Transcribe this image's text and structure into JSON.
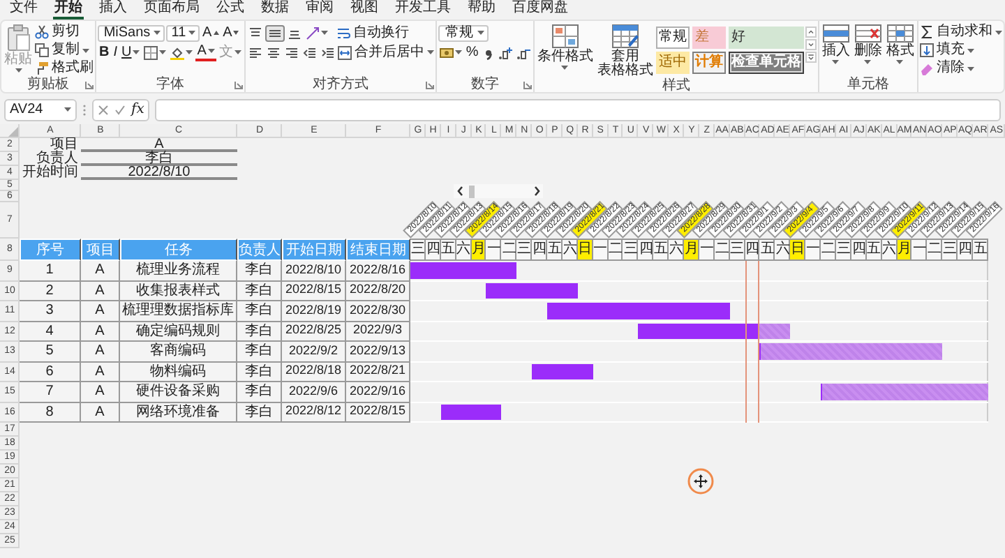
{
  "ribbon": {
    "tabs": [
      {
        "label": "文件",
        "selected": false
      },
      {
        "label": "开始",
        "selected": true
      },
      {
        "label": "插入",
        "selected": false
      },
      {
        "label": "页面布局",
        "selected": false
      },
      {
        "label": "公式",
        "selected": false
      },
      {
        "label": "数据",
        "selected": false
      },
      {
        "label": "审阅",
        "selected": false
      },
      {
        "label": "视图",
        "selected": false
      },
      {
        "label": "开发工具",
        "selected": false
      },
      {
        "label": "帮助",
        "selected": false
      },
      {
        "label": "百度网盘",
        "selected": false
      }
    ],
    "clipboard": {
      "paste": "粘贴",
      "cut": "剪切",
      "copy": "复制",
      "format_painter": "格式刷",
      "label": "剪贴板"
    },
    "font": {
      "name": "MiSans",
      "size": "11",
      "grow": "A",
      "shrink": "A",
      "bold": "B",
      "italic": "I",
      "underline": "U",
      "font_color": "A",
      "phonetic": "文",
      "label": "字体"
    },
    "alignment": {
      "vertical": [
        {
          "selected": false
        },
        {
          "selected": true
        },
        {
          "selected": false
        }
      ],
      "wrap_text": "自动换行",
      "merge_center": "合并后居中",
      "label": "对齐方式"
    },
    "number": {
      "format": "常规",
      "percent": "%",
      "label": "数字"
    },
    "styles": {
      "conditional_format": "条件格式",
      "table_format": [
        "套用",
        "表格格式"
      ],
      "cell_styles": [
        {
          "label": "常规",
          "kind": "normal"
        },
        {
          "label": "差",
          "kind": "bad"
        },
        {
          "label": "好",
          "kind": "good"
        },
        {
          "label": "适中",
          "kind": "neutral"
        },
        {
          "label": "计算",
          "kind": "calculation"
        },
        {
          "label": "检查单元格",
          "kind": "check"
        }
      ],
      "label": "样式"
    },
    "cells": {
      "insert": "插入",
      "delete": "删除",
      "format": "格式",
      "label": "单元格"
    },
    "editing": {
      "autosum": "自动求和",
      "fill": "填充",
      "clear": "清除"
    }
  },
  "formula_bar": {
    "name_box": "AV24",
    "fx": "fx"
  },
  "sheet": {
    "columns": [
      "A",
      "B",
      "C",
      "D",
      "E",
      "F",
      "G",
      "H",
      "I",
      "J",
      "K",
      "L",
      "M",
      "N",
      "O",
      "P",
      "Q",
      "R",
      "S",
      "T",
      "U",
      "V",
      "W",
      "X",
      "Y",
      "Z",
      "AA",
      "AB",
      "AC",
      "AD",
      "AE",
      "AF",
      "AG",
      "AH",
      "AI",
      "AJ",
      "AK",
      "AL",
      "AM",
      "AN",
      "AO",
      "AP",
      "AQ",
      "AR",
      "AS"
    ],
    "rows": [
      "2",
      "3",
      "4",
      "5",
      "6",
      "7",
      "8",
      "9",
      "10",
      "11",
      "12",
      "13",
      "14",
      "15",
      "16",
      "17",
      "18",
      "19",
      "20",
      "21",
      "22",
      "23",
      "24",
      "25"
    ],
    "info": [
      {
        "label": "项目",
        "value": "A"
      },
      {
        "label": "负责人",
        "value": "李白"
      },
      {
        "label": "开始时间",
        "value": "2022/8/10"
      }
    ],
    "table": {
      "headers": [
        "序号",
        "项目",
        "任务",
        "负责人",
        "开始日期",
        "结束日期"
      ],
      "tasks": [
        {
          "no": "1",
          "project": "A",
          "task": "梳理业务流程",
          "owner": "李白",
          "start": "2022/8/10",
          "end": "2022/8/16",
          "level": 1
        },
        {
          "no": "2",
          "project": "A",
          "task": "收集报表样式",
          "owner": "李白",
          "start": "2022/8/15",
          "end": "2022/8/20",
          "level": 1
        },
        {
          "no": "3",
          "project": "A",
          "task": "梳理理数据指标库",
          "owner": "李白",
          "start": "2022/8/19",
          "end": "2022/8/30",
          "level": 1
        },
        {
          "no": "4",
          "project": "A",
          "task": "确定编码规则",
          "owner": "李白",
          "start": "2022/8/25",
          "end": "2022/9/3",
          "level": 0.8
        },
        {
          "no": "5",
          "project": "A",
          "task": "客商编码",
          "owner": "李白",
          "start": "2022/9/2",
          "end": "2022/9/13",
          "level": 0
        },
        {
          "no": "6",
          "project": "A",
          "task": "物料编码",
          "owner": "李白",
          "start": "2022/8/18",
          "end": "2022/8/21",
          "level": 1
        },
        {
          "no": "7",
          "project": "A",
          "task": "硬件设备采购",
          "owner": "李白",
          "start": "2022/9/6",
          "end": "2022/9/16",
          "level": 0
        },
        {
          "no": "8",
          "project": "A",
          "task": "网络环境准备",
          "owner": "李白",
          "start": "2022/8/12",
          "end": "2022/8/15",
          "level": 1
        }
      ]
    },
    "timeline": {
      "days": [
        {
          "date": "2022/8/10",
          "weekday": "三",
          "highlighted": false,
          "today": false
        },
        {
          "date": "2022/8/11",
          "weekday": "四",
          "highlighted": false,
          "today": false
        },
        {
          "date": "2022/8/12",
          "weekday": "五",
          "highlighted": false,
          "today": false
        },
        {
          "date": "2022/8/13",
          "weekday": "六",
          "highlighted": false,
          "today": false
        },
        {
          "date": "2022/8/14",
          "weekday": "月",
          "highlighted": true,
          "today": false
        },
        {
          "date": "2022/8/15",
          "weekday": "一",
          "highlighted": false,
          "today": false
        },
        {
          "date": "2022/8/16",
          "weekday": "二",
          "highlighted": false,
          "today": false
        },
        {
          "date": "2022/8/17",
          "weekday": "三",
          "highlighted": false,
          "today": false
        },
        {
          "date": "2022/8/18",
          "weekday": "四",
          "highlighted": false,
          "today": false
        },
        {
          "date": "2022/8/19",
          "weekday": "五",
          "highlighted": false,
          "today": false
        },
        {
          "date": "2022/8/20",
          "weekday": "六",
          "highlighted": false,
          "today": false
        },
        {
          "date": "2022/8/21",
          "weekday": "日",
          "highlighted": true,
          "today": false
        },
        {
          "date": "2022/8/22",
          "weekday": "一",
          "highlighted": false,
          "today": false
        },
        {
          "date": "2022/8/23",
          "weekday": "二",
          "highlighted": false,
          "today": false
        },
        {
          "date": "2022/8/24",
          "weekday": "三",
          "highlighted": false,
          "today": false
        },
        {
          "date": "2022/8/25",
          "weekday": "四",
          "highlighted": false,
          "today": false
        },
        {
          "date": "2022/8/26",
          "weekday": "五",
          "highlighted": false,
          "today": false
        },
        {
          "date": "2022/8/27",
          "weekday": "六",
          "highlighted": false,
          "today": false
        },
        {
          "date": "2022/8/28",
          "weekday": "月",
          "highlighted": true,
          "today": false
        },
        {
          "date": "2022/8/29",
          "weekday": "一",
          "highlighted": false,
          "today": false
        },
        {
          "date": "2022/8/30",
          "weekday": "二",
          "highlighted": false,
          "today": false
        },
        {
          "date": "2022/8/31",
          "weekday": "三",
          "highlighted": false,
          "today": false
        },
        {
          "date": "2022/9/1",
          "weekday": "四",
          "highlighted": false,
          "today": true
        },
        {
          "date": "2022/9/2",
          "weekday": "五",
          "highlighted": false,
          "today": false
        },
        {
          "date": "2022/9/3",
          "weekday": "六",
          "highlighted": false,
          "today": false
        },
        {
          "date": "2022/9/4",
          "weekday": "日",
          "highlighted": true,
          "today": false
        },
        {
          "date": "2022/9/5",
          "weekday": "一",
          "highlighted": false,
          "today": false
        },
        {
          "date": "2022/9/6",
          "weekday": "二",
          "highlighted": false,
          "today": false
        },
        {
          "date": "2022/9/7",
          "weekday": "三",
          "highlighted": false,
          "today": false
        },
        {
          "date": "2022/9/8",
          "weekday": "四",
          "highlighted": false,
          "today": false
        },
        {
          "date": "2022/9/9",
          "weekday": "五",
          "highlighted": false,
          "today": false
        },
        {
          "date": "2022/9/10",
          "weekday": "六",
          "highlighted": false,
          "today": false
        },
        {
          "date": "2022/9/11",
          "weekday": "月",
          "highlighted": true,
          "today": false
        },
        {
          "date": "2022/9/12",
          "weekday": "一",
          "highlighted": false,
          "today": false
        },
        {
          "date": "2022/9/13",
          "weekday": "二",
          "highlighted": false,
          "today": false
        },
        {
          "date": "2022/9/14",
          "weekday": "三",
          "highlighted": false,
          "today": false
        },
        {
          "date": "2022/9/15",
          "weekday": "四",
          "highlighted": false,
          "today": false
        },
        {
          "date": "2022/9/16",
          "weekday": "五",
          "highlighted": false,
          "today": false
        }
      ]
    }
  }
}
